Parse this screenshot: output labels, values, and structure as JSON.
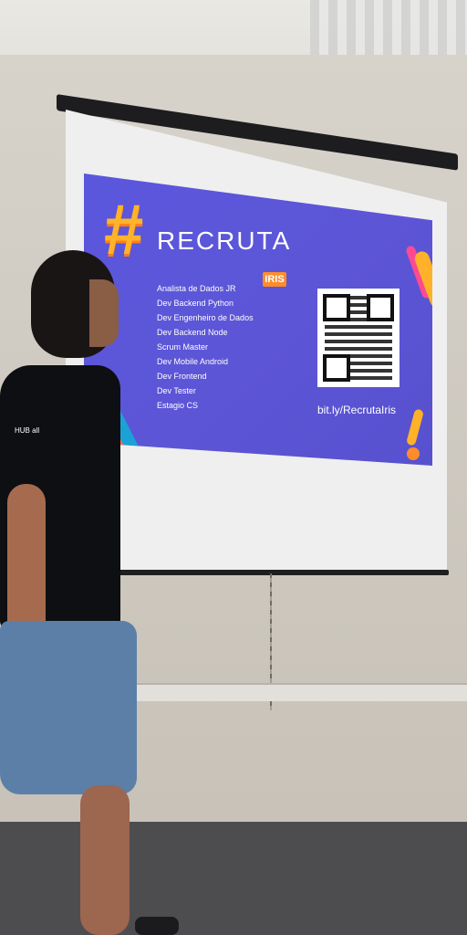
{
  "screen": {
    "title": "RECRUTA",
    "badge": "IRIS",
    "roles": [
      "Analista de Dados JR",
      "Dev Backend Python",
      "Dev Engenheiro de Dados",
      "Dev Backend Node",
      "Scrum Master",
      "Dev Mobile Android",
      "Dev Frontend",
      "Dev Tester",
      "Estagio CS"
    ],
    "url": "bit.ly/RecrutaIris"
  },
  "person": {
    "shirt_label": "HUB\nall"
  },
  "colors": {
    "slide_bg": "#5b57dd",
    "accent_orange": "#ffb32b",
    "accent_blue": "#1aa2d6",
    "accent_pink": "#ff4a93"
  }
}
